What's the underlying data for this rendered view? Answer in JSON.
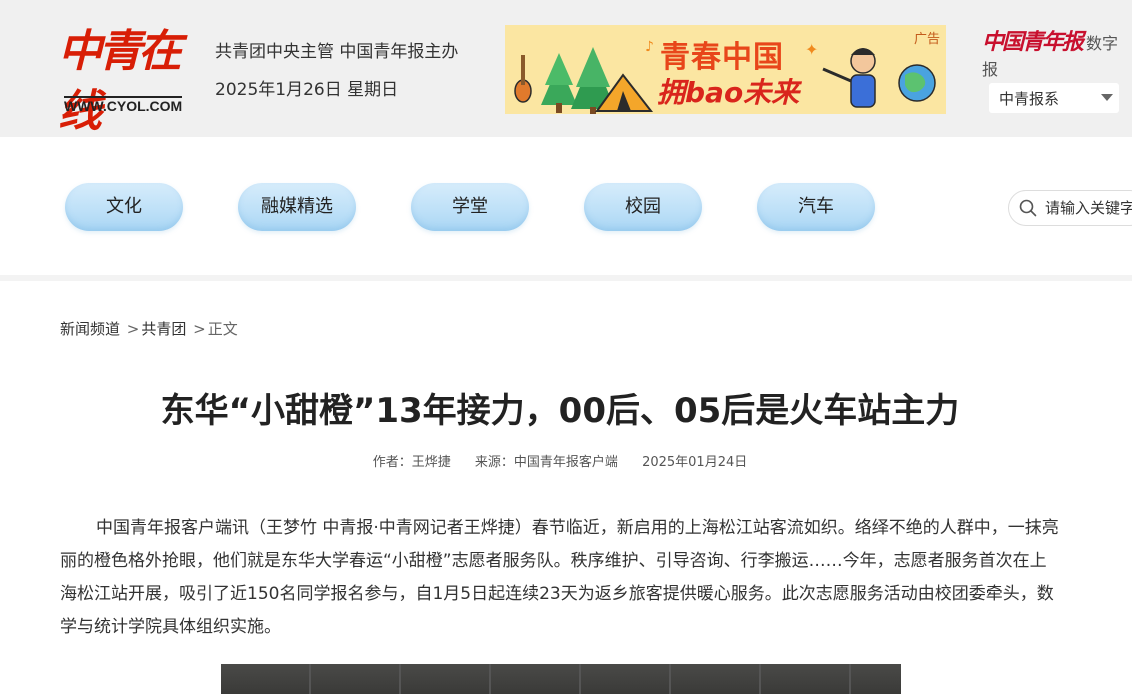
{
  "header": {
    "logo_cn": "中青在线",
    "logo_en": "WWW.CYOL.COM",
    "tagline": "共青团中央主管 中国青年报主办",
    "date": "2025年1月26日 星期日",
    "ad": {
      "tag": "广告",
      "title_line1": "青春中国",
      "title_line2": "拥bao未来"
    },
    "brand_right": {
      "name": "中国青年报",
      "sub": "数字报"
    },
    "select": {
      "value": "中青报系"
    }
  },
  "nav": {
    "items": [
      {
        "label": "文化"
      },
      {
        "label": "融媒精选"
      },
      {
        "label": "学堂"
      },
      {
        "label": "校园"
      },
      {
        "label": "汽车"
      }
    ],
    "search": {
      "placeholder": "请输入关键字"
    }
  },
  "article": {
    "breadcrumb": {
      "item1": "新闻频道",
      "sep1": ">",
      "item2": "共青团",
      "sep2": ">",
      "current": "正文"
    },
    "title": "东华“小甜橙”13年接力，00后、05后是火车站主力",
    "meta": {
      "author": "作者：王烨捷",
      "source": "来源：中国青年报客户端",
      "date": "2025年01月24日"
    },
    "body": "中国青年报客户端讯（王梦竹 中青报·中青网记者王烨捷）春节临近，新启用的上海松江站客流如织。络绎不绝的人群中，一抹亮丽的橙色格外抢眼，他们就是东华大学春运“小甜橙”志愿者服务队。秩序维护、引导咨询、行李搬运……今年，志愿者服务首次在上海松江站开展，吸引了近150名同学报名参与，自1月5日起连续23天为返乡旅客提供暖心服务。此次志愿服务活动由校团委牵头，数学与统计学院具体组织实施。"
  },
  "colors": {
    "brand_red": "#d81e06",
    "nav_pill": "#bfe1f8",
    "header_bg": "#f0f0f0"
  }
}
